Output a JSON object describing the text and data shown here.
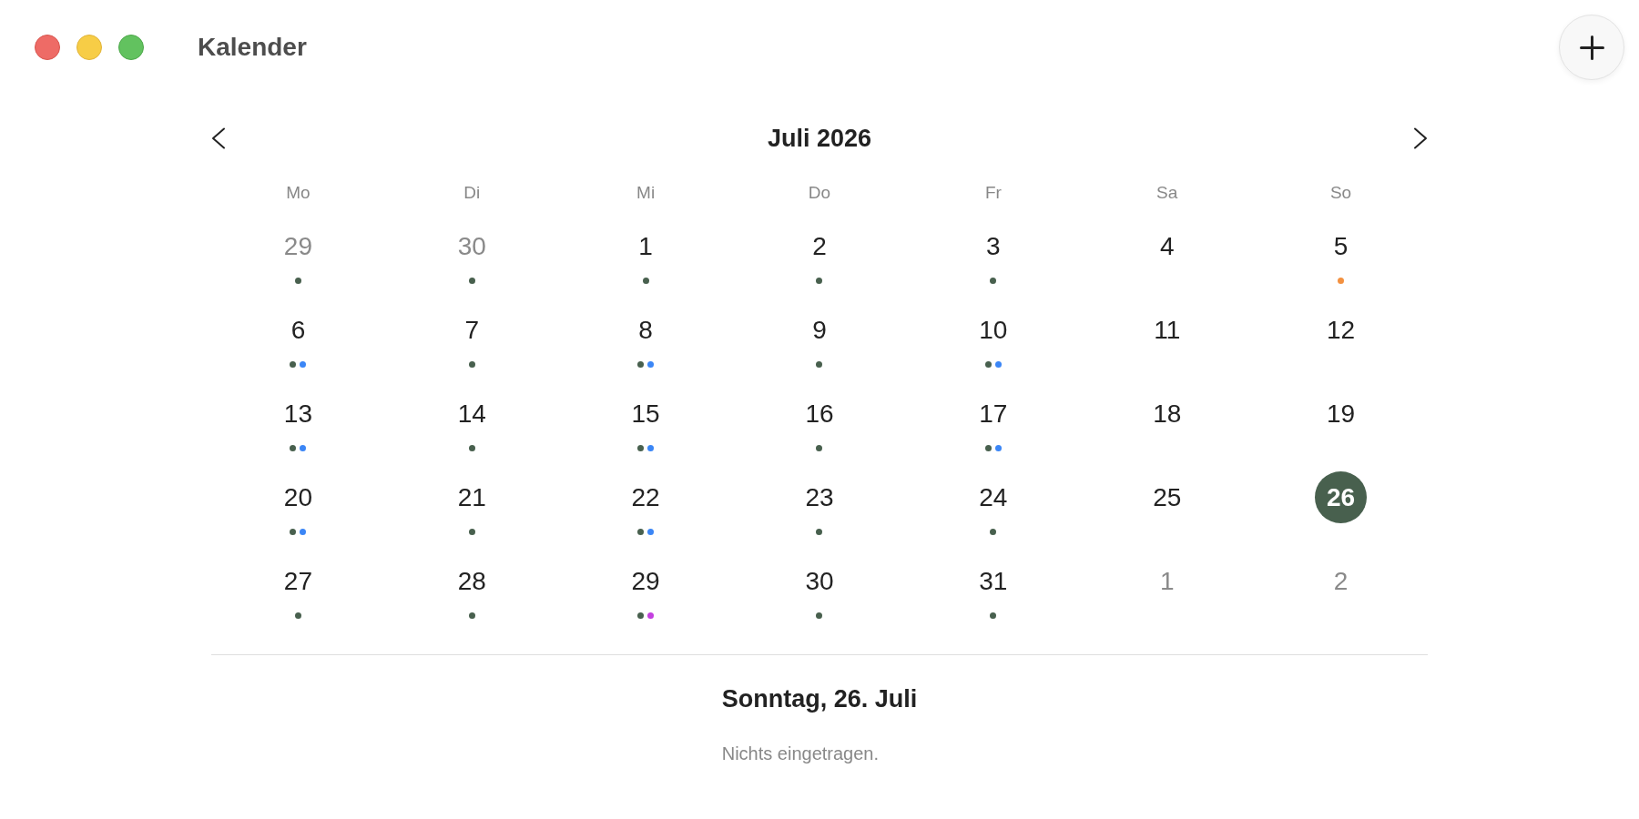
{
  "window": {
    "title": "Kalender",
    "controls": [
      {
        "kind": "close"
      },
      {
        "kind": "minimize"
      },
      {
        "kind": "zoom"
      }
    ]
  },
  "calendar": {
    "title": "Juli 2026",
    "weekdays": [
      "Mo",
      "Di",
      "Mi",
      "Do",
      "Fr",
      "Sa",
      "So"
    ],
    "days": [
      {
        "label": "29",
        "in_month": false,
        "selected": false,
        "events": [
          {
            "color": "#48604e"
          }
        ]
      },
      {
        "label": "30",
        "in_month": false,
        "selected": false,
        "events": [
          {
            "color": "#48604e"
          }
        ]
      },
      {
        "label": "1",
        "in_month": true,
        "selected": false,
        "events": [
          {
            "color": "#48604e"
          }
        ]
      },
      {
        "label": "2",
        "in_month": true,
        "selected": false,
        "events": [
          {
            "color": "#48604e"
          }
        ]
      },
      {
        "label": "3",
        "in_month": true,
        "selected": false,
        "events": [
          {
            "color": "#48604e"
          }
        ]
      },
      {
        "label": "4",
        "in_month": true,
        "selected": false
      },
      {
        "label": "5",
        "in_month": true,
        "selected": false,
        "events": [
          {
            "color": "#f39140"
          }
        ]
      },
      {
        "label": "6",
        "in_month": true,
        "selected": false,
        "events": [
          {
            "color": "#48604e"
          },
          {
            "color": "#3b86f6"
          }
        ]
      },
      {
        "label": "7",
        "in_month": true,
        "selected": false,
        "events": [
          {
            "color": "#48604e"
          }
        ]
      },
      {
        "label": "8",
        "in_month": true,
        "selected": false,
        "events": [
          {
            "color": "#48604e"
          },
          {
            "color": "#3b86f6"
          }
        ]
      },
      {
        "label": "9",
        "in_month": true,
        "selected": false,
        "events": [
          {
            "color": "#48604e"
          }
        ]
      },
      {
        "label": "10",
        "in_month": true,
        "selected": false,
        "events": [
          {
            "color": "#48604e"
          },
          {
            "color": "#3b86f6"
          }
        ]
      },
      {
        "label": "11",
        "in_month": true,
        "selected": false
      },
      {
        "label": "12",
        "in_month": true,
        "selected": false
      },
      {
        "label": "13",
        "in_month": true,
        "selected": false,
        "events": [
          {
            "color": "#48604e"
          },
          {
            "color": "#3b86f6"
          }
        ]
      },
      {
        "label": "14",
        "in_month": true,
        "selected": false,
        "events": [
          {
            "color": "#48604e"
          }
        ]
      },
      {
        "label": "15",
        "in_month": true,
        "selected": false,
        "events": [
          {
            "color": "#48604e"
          },
          {
            "color": "#3b86f6"
          }
        ]
      },
      {
        "label": "16",
        "in_month": true,
        "selected": false,
        "events": [
          {
            "color": "#48604e"
          }
        ]
      },
      {
        "label": "17",
        "in_month": true,
        "selected": false,
        "events": [
          {
            "color": "#48604e"
          },
          {
            "color": "#3b86f6"
          }
        ]
      },
      {
        "label": "18",
        "in_month": true,
        "selected": false
      },
      {
        "label": "19",
        "in_month": true,
        "selected": false
      },
      {
        "label": "20",
        "in_month": true,
        "selected": false,
        "events": [
          {
            "color": "#48604e"
          },
          {
            "color": "#3b86f6"
          }
        ]
      },
      {
        "label": "21",
        "in_month": true,
        "selected": false,
        "events": [
          {
            "color": "#48604e"
          }
        ]
      },
      {
        "label": "22",
        "in_month": true,
        "selected": false,
        "events": [
          {
            "color": "#48604e"
          },
          {
            "color": "#3b86f6"
          }
        ]
      },
      {
        "label": "23",
        "in_month": true,
        "selected": false,
        "events": [
          {
            "color": "#48604e"
          }
        ]
      },
      {
        "label": "24",
        "in_month": true,
        "selected": false,
        "events": [
          {
            "color": "#48604e"
          }
        ]
      },
      {
        "label": "25",
        "in_month": true,
        "selected": false
      },
      {
        "label": "26",
        "in_month": true,
        "selected": true
      },
      {
        "label": "27",
        "in_month": true,
        "selected": false,
        "events": [
          {
            "color": "#48604e"
          }
        ]
      },
      {
        "label": "28",
        "in_month": true,
        "selected": false,
        "events": [
          {
            "color": "#48604e"
          }
        ]
      },
      {
        "label": "29",
        "in_month": true,
        "selected": false,
        "events": [
          {
            "color": "#48604e"
          },
          {
            "color": "#c43fe0"
          }
        ]
      },
      {
        "label": "30",
        "in_month": true,
        "selected": false,
        "events": [
          {
            "color": "#48604e"
          }
        ]
      },
      {
        "label": "31",
        "in_month": true,
        "selected": false,
        "events": [
          {
            "color": "#48604e"
          }
        ]
      },
      {
        "label": "1",
        "in_month": false,
        "selected": false
      },
      {
        "label": "2",
        "in_month": false,
        "selected": false
      }
    ]
  },
  "detail": {
    "title": "Sonntag, 26. Juli",
    "empty_text": "Nichts eingetragen."
  }
}
